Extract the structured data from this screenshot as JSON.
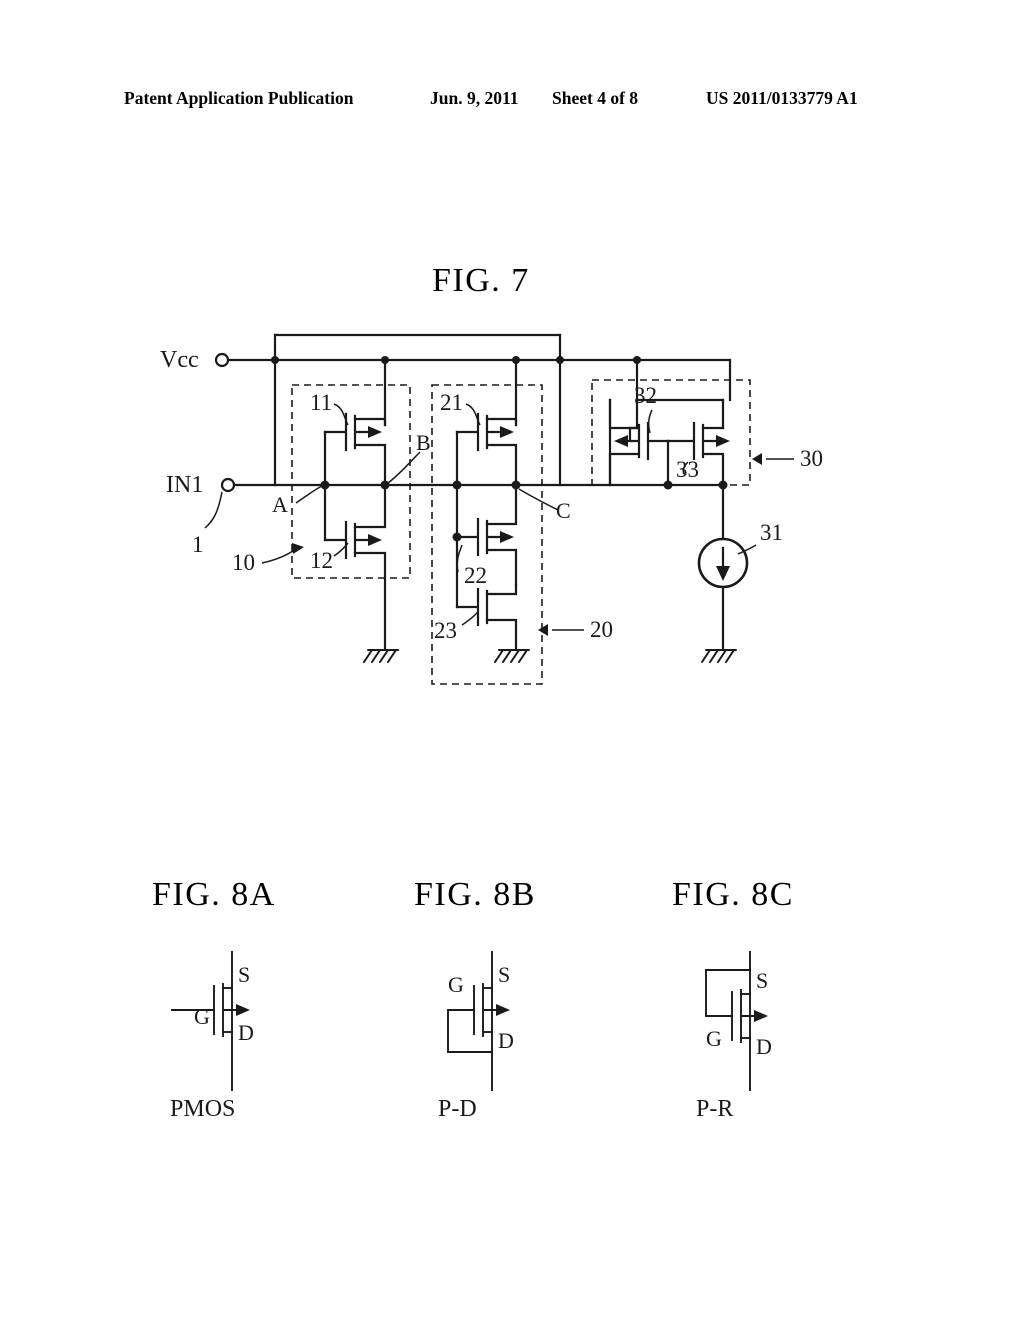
{
  "header": {
    "publication": "Patent Application Publication",
    "date": "Jun. 9, 2011",
    "sheet": "Sheet 4 of 8",
    "number": "US 2011/0133779 A1"
  },
  "figures": {
    "fig7": {
      "title": "FIG. 7",
      "pins": {
        "vcc": "Vcc",
        "in1": "IN1"
      },
      "nodes": {
        "a": "A",
        "b": "B",
        "c": "C"
      },
      "refs": {
        "input_ref": "1",
        "block10": "10",
        "tr11": "11",
        "tr12": "12",
        "block20": "20",
        "tr21": "21",
        "tr22": "22",
        "tr23": "23",
        "block30": "30",
        "cs31": "31",
        "tr32": "32",
        "tr33": "33"
      }
    },
    "fig8a": {
      "title": "FIG. 8A",
      "caption": "PMOS",
      "gate": "G",
      "source": "S",
      "drain": "D"
    },
    "fig8b": {
      "title": "FIG. 8B",
      "caption": "P-D",
      "gate": "G",
      "source": "S",
      "drain": "D"
    },
    "fig8c": {
      "title": "FIG. 8C",
      "caption": "P-R",
      "gate": "G",
      "source": "S",
      "drain": "D"
    }
  },
  "colors": {
    "ink": "#1a1a1a",
    "paper": "#ffffff"
  }
}
